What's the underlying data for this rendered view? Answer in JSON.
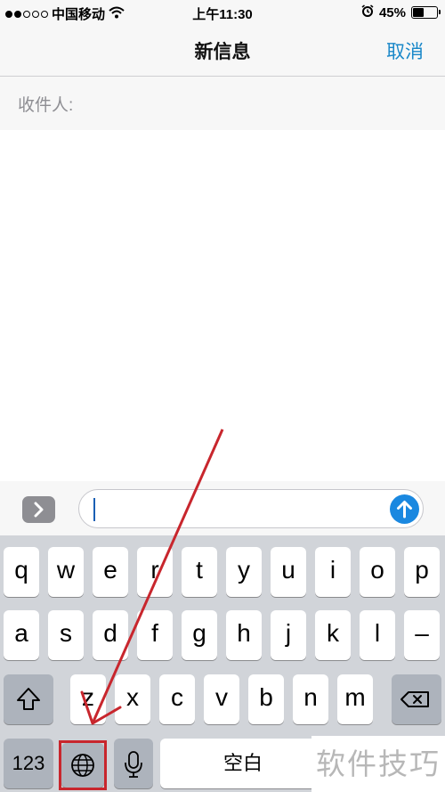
{
  "status_bar": {
    "carrier": "中国移动",
    "time": "上午11:30",
    "battery_percent": "45%",
    "battery_level": 0.45,
    "signal_bars_filled": 2,
    "signal_bars_total": 5
  },
  "nav": {
    "title": "新信息",
    "cancel_label": "取消"
  },
  "recipient": {
    "label": "收件人:"
  },
  "compose": {
    "apps_button_icon": "chevron-right-icon",
    "send_button_icon": "arrow-up-icon",
    "message_value": ""
  },
  "keyboard": {
    "row1": [
      "q",
      "w",
      "e",
      "r",
      "t",
      "y",
      "u",
      "i",
      "o",
      "p"
    ],
    "row2": [
      "a",
      "s",
      "d",
      "f",
      "g",
      "h",
      "j",
      "k",
      "l",
      "–"
    ],
    "row3": [
      "z",
      "x",
      "c",
      "v",
      "b",
      "n",
      "m"
    ],
    "numbers_label": "123",
    "space_label": "空白",
    "shift_icon": "shift-icon",
    "delete_icon": "backspace-icon",
    "globe_icon": "globe-icon",
    "mic_icon": "microphone-icon"
  },
  "annotation": {
    "arrow_color": "#c8262d",
    "highlight": "globe-key"
  },
  "watermark": "软件技巧",
  "colors": {
    "accent": "#1a88c9",
    "keyboard_bg": "#d1d4d9",
    "dark_key": "#adb3bc"
  }
}
